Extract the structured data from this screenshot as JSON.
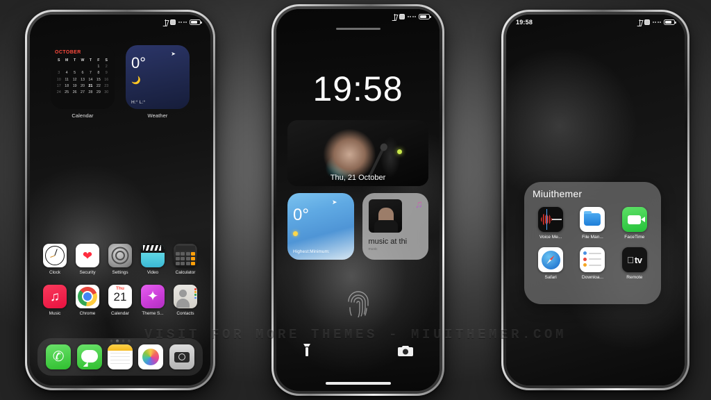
{
  "watermark": "VISIT FOR MORE THEMES - MIUITHEMER.COM",
  "phone1": {
    "status": {
      "time": "",
      "icons": [
        "bluetooth-icon",
        "alarm-icon",
        "signal-dots",
        "battery-icon"
      ]
    },
    "widgets": [
      {
        "name": "Calendar",
        "month": "OCTOBER",
        "dow": [
          "S",
          "M",
          "T",
          "W",
          "T",
          "F",
          "S"
        ],
        "cells": [
          "",
          "",
          "",
          "",
          "",
          "1",
          "2",
          "3",
          "4",
          "5",
          "6",
          "7",
          "8",
          "9",
          "10",
          "11",
          "12",
          "13",
          "14",
          "15",
          "16",
          "17",
          "18",
          "19",
          "20",
          "21",
          "22",
          "23",
          "24",
          "25",
          "26",
          "27",
          "28",
          "29",
          "30"
        ],
        "today": "21",
        "accent": "#ff4a1e"
      },
      {
        "name": "Weather",
        "temp": "0°",
        "high_low": "H:°  L:°",
        "condition_icon": "crescent-moon-icon",
        "location_icon": "location-arrow-icon"
      }
    ],
    "apps_row1": [
      {
        "label": "Clock",
        "icon": "clock-icon"
      },
      {
        "label": "Security",
        "icon": "heart-icon"
      },
      {
        "label": "Settings",
        "icon": "gear-icon"
      },
      {
        "label": "Video",
        "icon": "clapperboard-icon"
      },
      {
        "label": "Calculator",
        "icon": "calculator-icon"
      }
    ],
    "apps_row2": [
      {
        "label": "Music",
        "icon": "music-note-icon"
      },
      {
        "label": "Chrome",
        "icon": "chrome-icon"
      },
      {
        "label": "Calendar",
        "icon": "calendar-icon",
        "day_name": "Thu",
        "day_num": "21"
      },
      {
        "label": "Theme S...",
        "icon": "star-icon"
      },
      {
        "label": "Contacts",
        "icon": "person-icon"
      }
    ],
    "page_dots": {
      "count": 4,
      "active_index": 1
    },
    "dock": [
      {
        "label": "Phone",
        "icon": "phone-icon"
      },
      {
        "label": "Messages",
        "icon": "message-bubble-icon"
      },
      {
        "label": "Notes",
        "icon": "notes-icon"
      },
      {
        "label": "Photos",
        "icon": "photos-flower-icon"
      },
      {
        "label": "Camera",
        "icon": "camera-icon"
      }
    ]
  },
  "phone2": {
    "status": {
      "time": "",
      "icons": [
        "bluetooth-icon",
        "alarm-icon",
        "signal-dots",
        "battery-icon"
      ]
    },
    "clock": "19:58",
    "photo_widget": {
      "date": "Thu, 21 October"
    },
    "weather_widget": {
      "temp": "0°",
      "summary": "Highest:Minimum:",
      "location_icon": "location-arrow-icon",
      "condition_icon": "sun-icon"
    },
    "music_widget": {
      "title": "music at thi",
      "subtitle": "music",
      "app_icon": "apple-music-note-icon"
    },
    "unlock": {
      "icon": "fingerprint-icon"
    },
    "bottom_left": {
      "icon": "flashlight-icon"
    },
    "bottom_right": {
      "icon": "camera-icon"
    }
  },
  "phone3": {
    "status": {
      "time": "19:58",
      "icons": [
        "bluetooth-icon",
        "alarm-icon",
        "signal-dots",
        "battery-icon"
      ]
    },
    "folder": {
      "name": "Miuithemer",
      "apps": [
        {
          "label": "Voice Me...",
          "icon": "voice-memos-icon"
        },
        {
          "label": "File Man...",
          "icon": "file-manager-icon"
        },
        {
          "label": "FaceTime",
          "icon": "facetime-icon"
        },
        {
          "label": "Safari",
          "icon": "safari-compass-icon"
        },
        {
          "label": "Downloa...",
          "icon": "downloads-list-icon"
        },
        {
          "label": "Remote",
          "icon": "apple-tv-icon"
        }
      ]
    }
  }
}
